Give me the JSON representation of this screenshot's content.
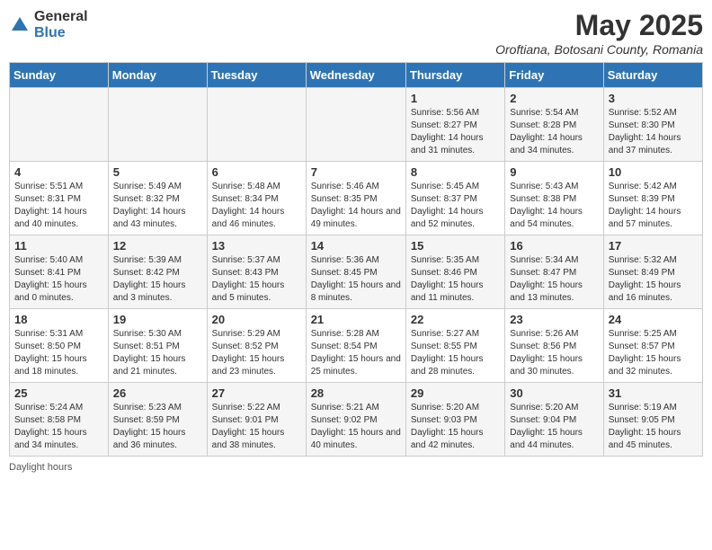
{
  "logo": {
    "general": "General",
    "blue": "Blue"
  },
  "title": "May 2025",
  "location": "Oroftiana, Botosani County, Romania",
  "days_of_week": [
    "Sunday",
    "Monday",
    "Tuesday",
    "Wednesday",
    "Thursday",
    "Friday",
    "Saturday"
  ],
  "footer": "Daylight hours",
  "weeks": [
    [
      {
        "day": "",
        "info": ""
      },
      {
        "day": "",
        "info": ""
      },
      {
        "day": "",
        "info": ""
      },
      {
        "day": "",
        "info": ""
      },
      {
        "day": "1",
        "info": "Sunrise: 5:56 AM\nSunset: 8:27 PM\nDaylight: 14 hours and 31 minutes."
      },
      {
        "day": "2",
        "info": "Sunrise: 5:54 AM\nSunset: 8:28 PM\nDaylight: 14 hours and 34 minutes."
      },
      {
        "day": "3",
        "info": "Sunrise: 5:52 AM\nSunset: 8:30 PM\nDaylight: 14 hours and 37 minutes."
      }
    ],
    [
      {
        "day": "4",
        "info": "Sunrise: 5:51 AM\nSunset: 8:31 PM\nDaylight: 14 hours and 40 minutes."
      },
      {
        "day": "5",
        "info": "Sunrise: 5:49 AM\nSunset: 8:32 PM\nDaylight: 14 hours and 43 minutes."
      },
      {
        "day": "6",
        "info": "Sunrise: 5:48 AM\nSunset: 8:34 PM\nDaylight: 14 hours and 46 minutes."
      },
      {
        "day": "7",
        "info": "Sunrise: 5:46 AM\nSunset: 8:35 PM\nDaylight: 14 hours and 49 minutes."
      },
      {
        "day": "8",
        "info": "Sunrise: 5:45 AM\nSunset: 8:37 PM\nDaylight: 14 hours and 52 minutes."
      },
      {
        "day": "9",
        "info": "Sunrise: 5:43 AM\nSunset: 8:38 PM\nDaylight: 14 hours and 54 minutes."
      },
      {
        "day": "10",
        "info": "Sunrise: 5:42 AM\nSunset: 8:39 PM\nDaylight: 14 hours and 57 minutes."
      }
    ],
    [
      {
        "day": "11",
        "info": "Sunrise: 5:40 AM\nSunset: 8:41 PM\nDaylight: 15 hours and 0 minutes."
      },
      {
        "day": "12",
        "info": "Sunrise: 5:39 AM\nSunset: 8:42 PM\nDaylight: 15 hours and 3 minutes."
      },
      {
        "day": "13",
        "info": "Sunrise: 5:37 AM\nSunset: 8:43 PM\nDaylight: 15 hours and 5 minutes."
      },
      {
        "day": "14",
        "info": "Sunrise: 5:36 AM\nSunset: 8:45 PM\nDaylight: 15 hours and 8 minutes."
      },
      {
        "day": "15",
        "info": "Sunrise: 5:35 AM\nSunset: 8:46 PM\nDaylight: 15 hours and 11 minutes."
      },
      {
        "day": "16",
        "info": "Sunrise: 5:34 AM\nSunset: 8:47 PM\nDaylight: 15 hours and 13 minutes."
      },
      {
        "day": "17",
        "info": "Sunrise: 5:32 AM\nSunset: 8:49 PM\nDaylight: 15 hours and 16 minutes."
      }
    ],
    [
      {
        "day": "18",
        "info": "Sunrise: 5:31 AM\nSunset: 8:50 PM\nDaylight: 15 hours and 18 minutes."
      },
      {
        "day": "19",
        "info": "Sunrise: 5:30 AM\nSunset: 8:51 PM\nDaylight: 15 hours and 21 minutes."
      },
      {
        "day": "20",
        "info": "Sunrise: 5:29 AM\nSunset: 8:52 PM\nDaylight: 15 hours and 23 minutes."
      },
      {
        "day": "21",
        "info": "Sunrise: 5:28 AM\nSunset: 8:54 PM\nDaylight: 15 hours and 25 minutes."
      },
      {
        "day": "22",
        "info": "Sunrise: 5:27 AM\nSunset: 8:55 PM\nDaylight: 15 hours and 28 minutes."
      },
      {
        "day": "23",
        "info": "Sunrise: 5:26 AM\nSunset: 8:56 PM\nDaylight: 15 hours and 30 minutes."
      },
      {
        "day": "24",
        "info": "Sunrise: 5:25 AM\nSunset: 8:57 PM\nDaylight: 15 hours and 32 minutes."
      }
    ],
    [
      {
        "day": "25",
        "info": "Sunrise: 5:24 AM\nSunset: 8:58 PM\nDaylight: 15 hours and 34 minutes."
      },
      {
        "day": "26",
        "info": "Sunrise: 5:23 AM\nSunset: 8:59 PM\nDaylight: 15 hours and 36 minutes."
      },
      {
        "day": "27",
        "info": "Sunrise: 5:22 AM\nSunset: 9:01 PM\nDaylight: 15 hours and 38 minutes."
      },
      {
        "day": "28",
        "info": "Sunrise: 5:21 AM\nSunset: 9:02 PM\nDaylight: 15 hours and 40 minutes."
      },
      {
        "day": "29",
        "info": "Sunrise: 5:20 AM\nSunset: 9:03 PM\nDaylight: 15 hours and 42 minutes."
      },
      {
        "day": "30",
        "info": "Sunrise: 5:20 AM\nSunset: 9:04 PM\nDaylight: 15 hours and 44 minutes."
      },
      {
        "day": "31",
        "info": "Sunrise: 5:19 AM\nSunset: 9:05 PM\nDaylight: 15 hours and 45 minutes."
      }
    ]
  ]
}
